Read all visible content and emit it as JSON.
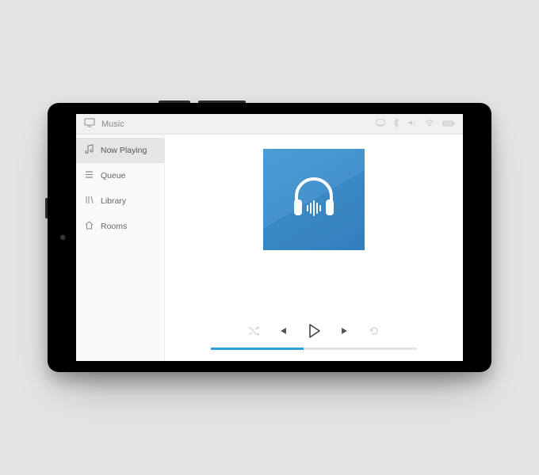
{
  "app": {
    "title": "Music"
  },
  "sidebar": {
    "items": [
      {
        "label": "Now Playing"
      },
      {
        "label": "Queue"
      },
      {
        "label": "Library"
      },
      {
        "label": "Rooms"
      }
    ]
  },
  "player": {
    "progress_percent": 45
  },
  "colors": {
    "accent": "#2a9fd8"
  }
}
